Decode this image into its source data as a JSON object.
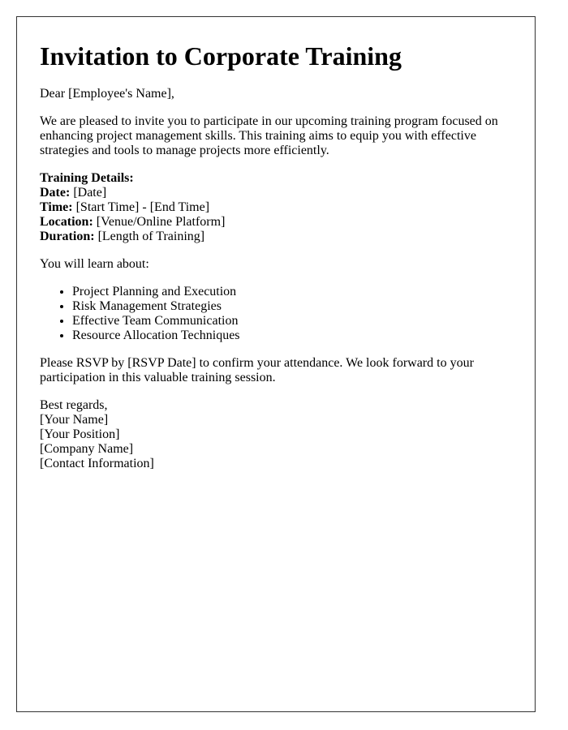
{
  "title": "Invitation to Corporate Training",
  "greeting": "Dear [Employee's Name],",
  "intro": "We are pleased to invite you to participate in our upcoming training program focused on enhancing project management skills. This training aims to equip you with effective strategies and tools to manage projects more efficiently.",
  "details": {
    "heading": "Training Details:",
    "items": [
      {
        "label": "Date:",
        "value": " [Date]"
      },
      {
        "label": "Time:",
        "value": " [Start Time] - [End Time]"
      },
      {
        "label": "Location:",
        "value": " [Venue/Online Platform]"
      },
      {
        "label": "Duration:",
        "value": " [Length of Training]"
      }
    ]
  },
  "learn_intro": "You will learn about:",
  "topics": [
    "Project Planning and Execution",
    "Risk Management Strategies",
    "Effective Team Communication",
    "Resource Allocation Techniques"
  ],
  "rsvp": "Please RSVP by [RSVP Date] to confirm your attendance. We look forward to your participation in this valuable training session.",
  "signature": {
    "closing": "Best regards,",
    "lines": [
      "[Your Name]",
      "[Your Position]",
      "[Company Name]",
      "[Contact Information]"
    ]
  }
}
